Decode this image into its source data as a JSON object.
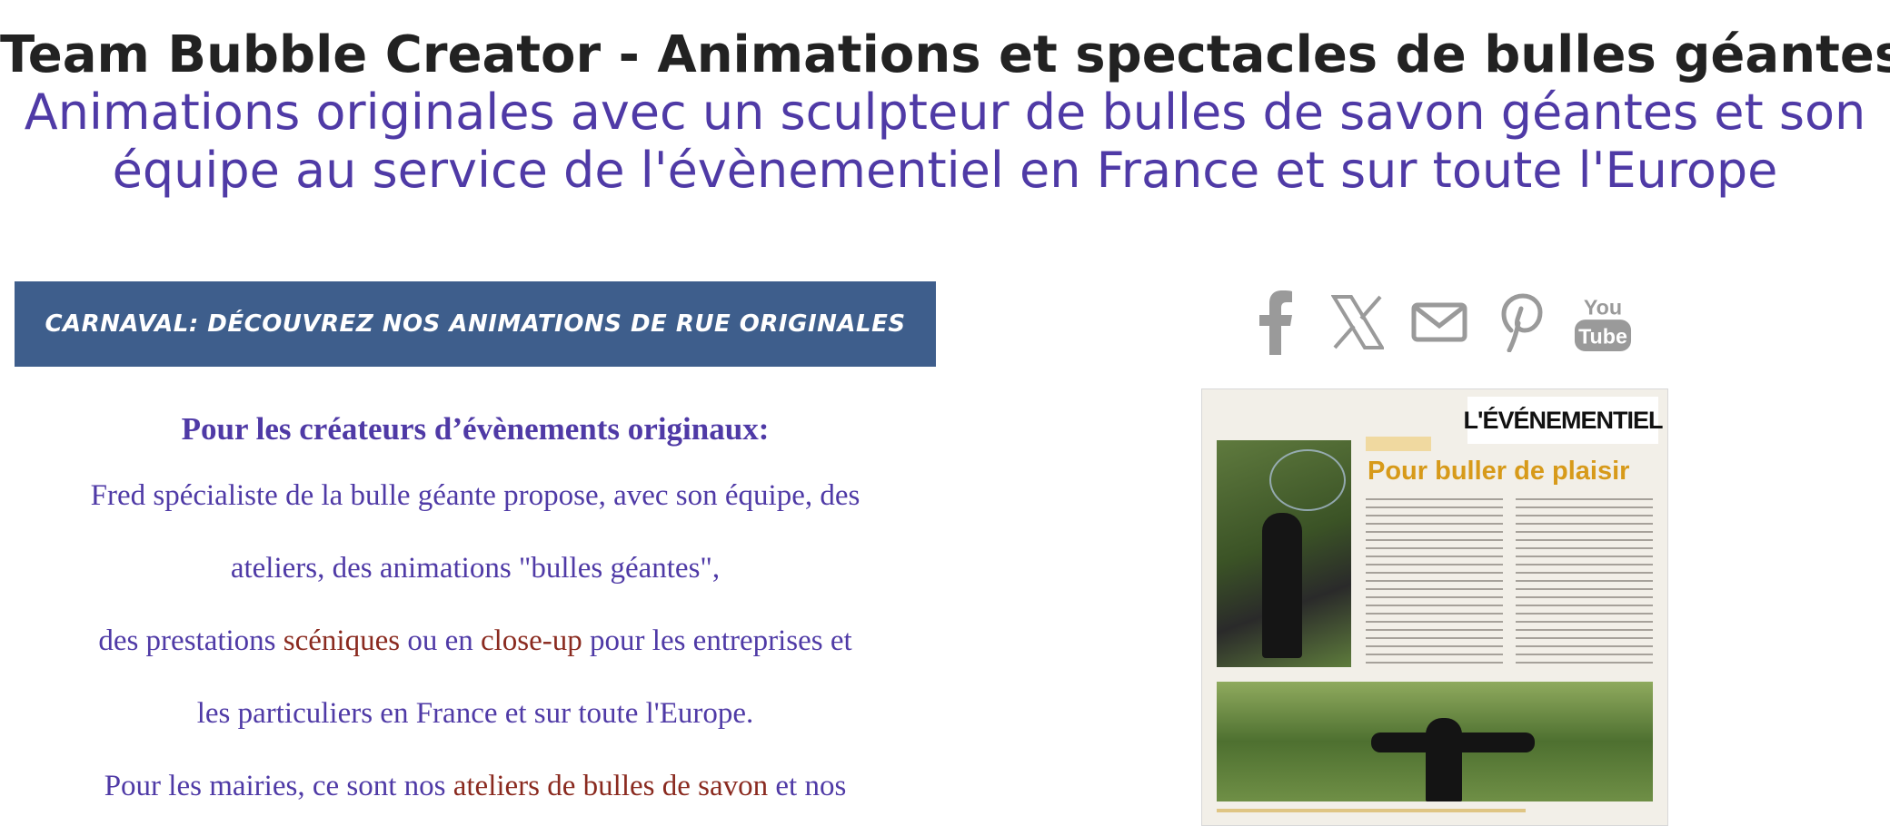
{
  "header": {
    "title": "Team Bubble Creator - Animations et spectacles de bulles géantes",
    "subtitle": "Animations originales avec un sculpteur de bulles de savon géantes et son équipe au service de l'évènementiel en France et sur toute l'Europe"
  },
  "banner": {
    "label": "CARNAVAL: DÉCOUVREZ NOS ANIMATIONS DE RUE ORIGINALES"
  },
  "content": {
    "lead": "Pour les créateurs d’évènements originaux:",
    "line1": "Fred spécialiste de la bulle géante propose, avec son équipe, des",
    "line2": "ateliers, des animations \"bulles géantes\",",
    "line3_a": "des prestations ",
    "line3_link1": "scéniques",
    "line3_b": " ou en ",
    "line3_link2": "close-up",
    "line3_c": " pour les entreprises et",
    "line4": "les particuliers en France et sur toute l'Europe.",
    "line5_a": "Pour les mairies, ce sont nos ",
    "line5_link": "ateliers de bulles de savon",
    "line5_b": " et nos"
  },
  "social": {
    "icons": [
      "facebook-icon",
      "x-icon",
      "email-icon",
      "pinterest-icon",
      "youtube-icon"
    ],
    "youtube_top": "You",
    "youtube_bottom": "Tube",
    "color": "#9a9a9a"
  },
  "press": {
    "masthead": "L'ÉVÉNEMENTIEL",
    "title": "Pour buller de plaisir"
  },
  "colors": {
    "title": "#222222",
    "subtitle": "#4f3aa6",
    "banner_bg": "#3e5e8c",
    "accent": "#8a2a1f"
  }
}
